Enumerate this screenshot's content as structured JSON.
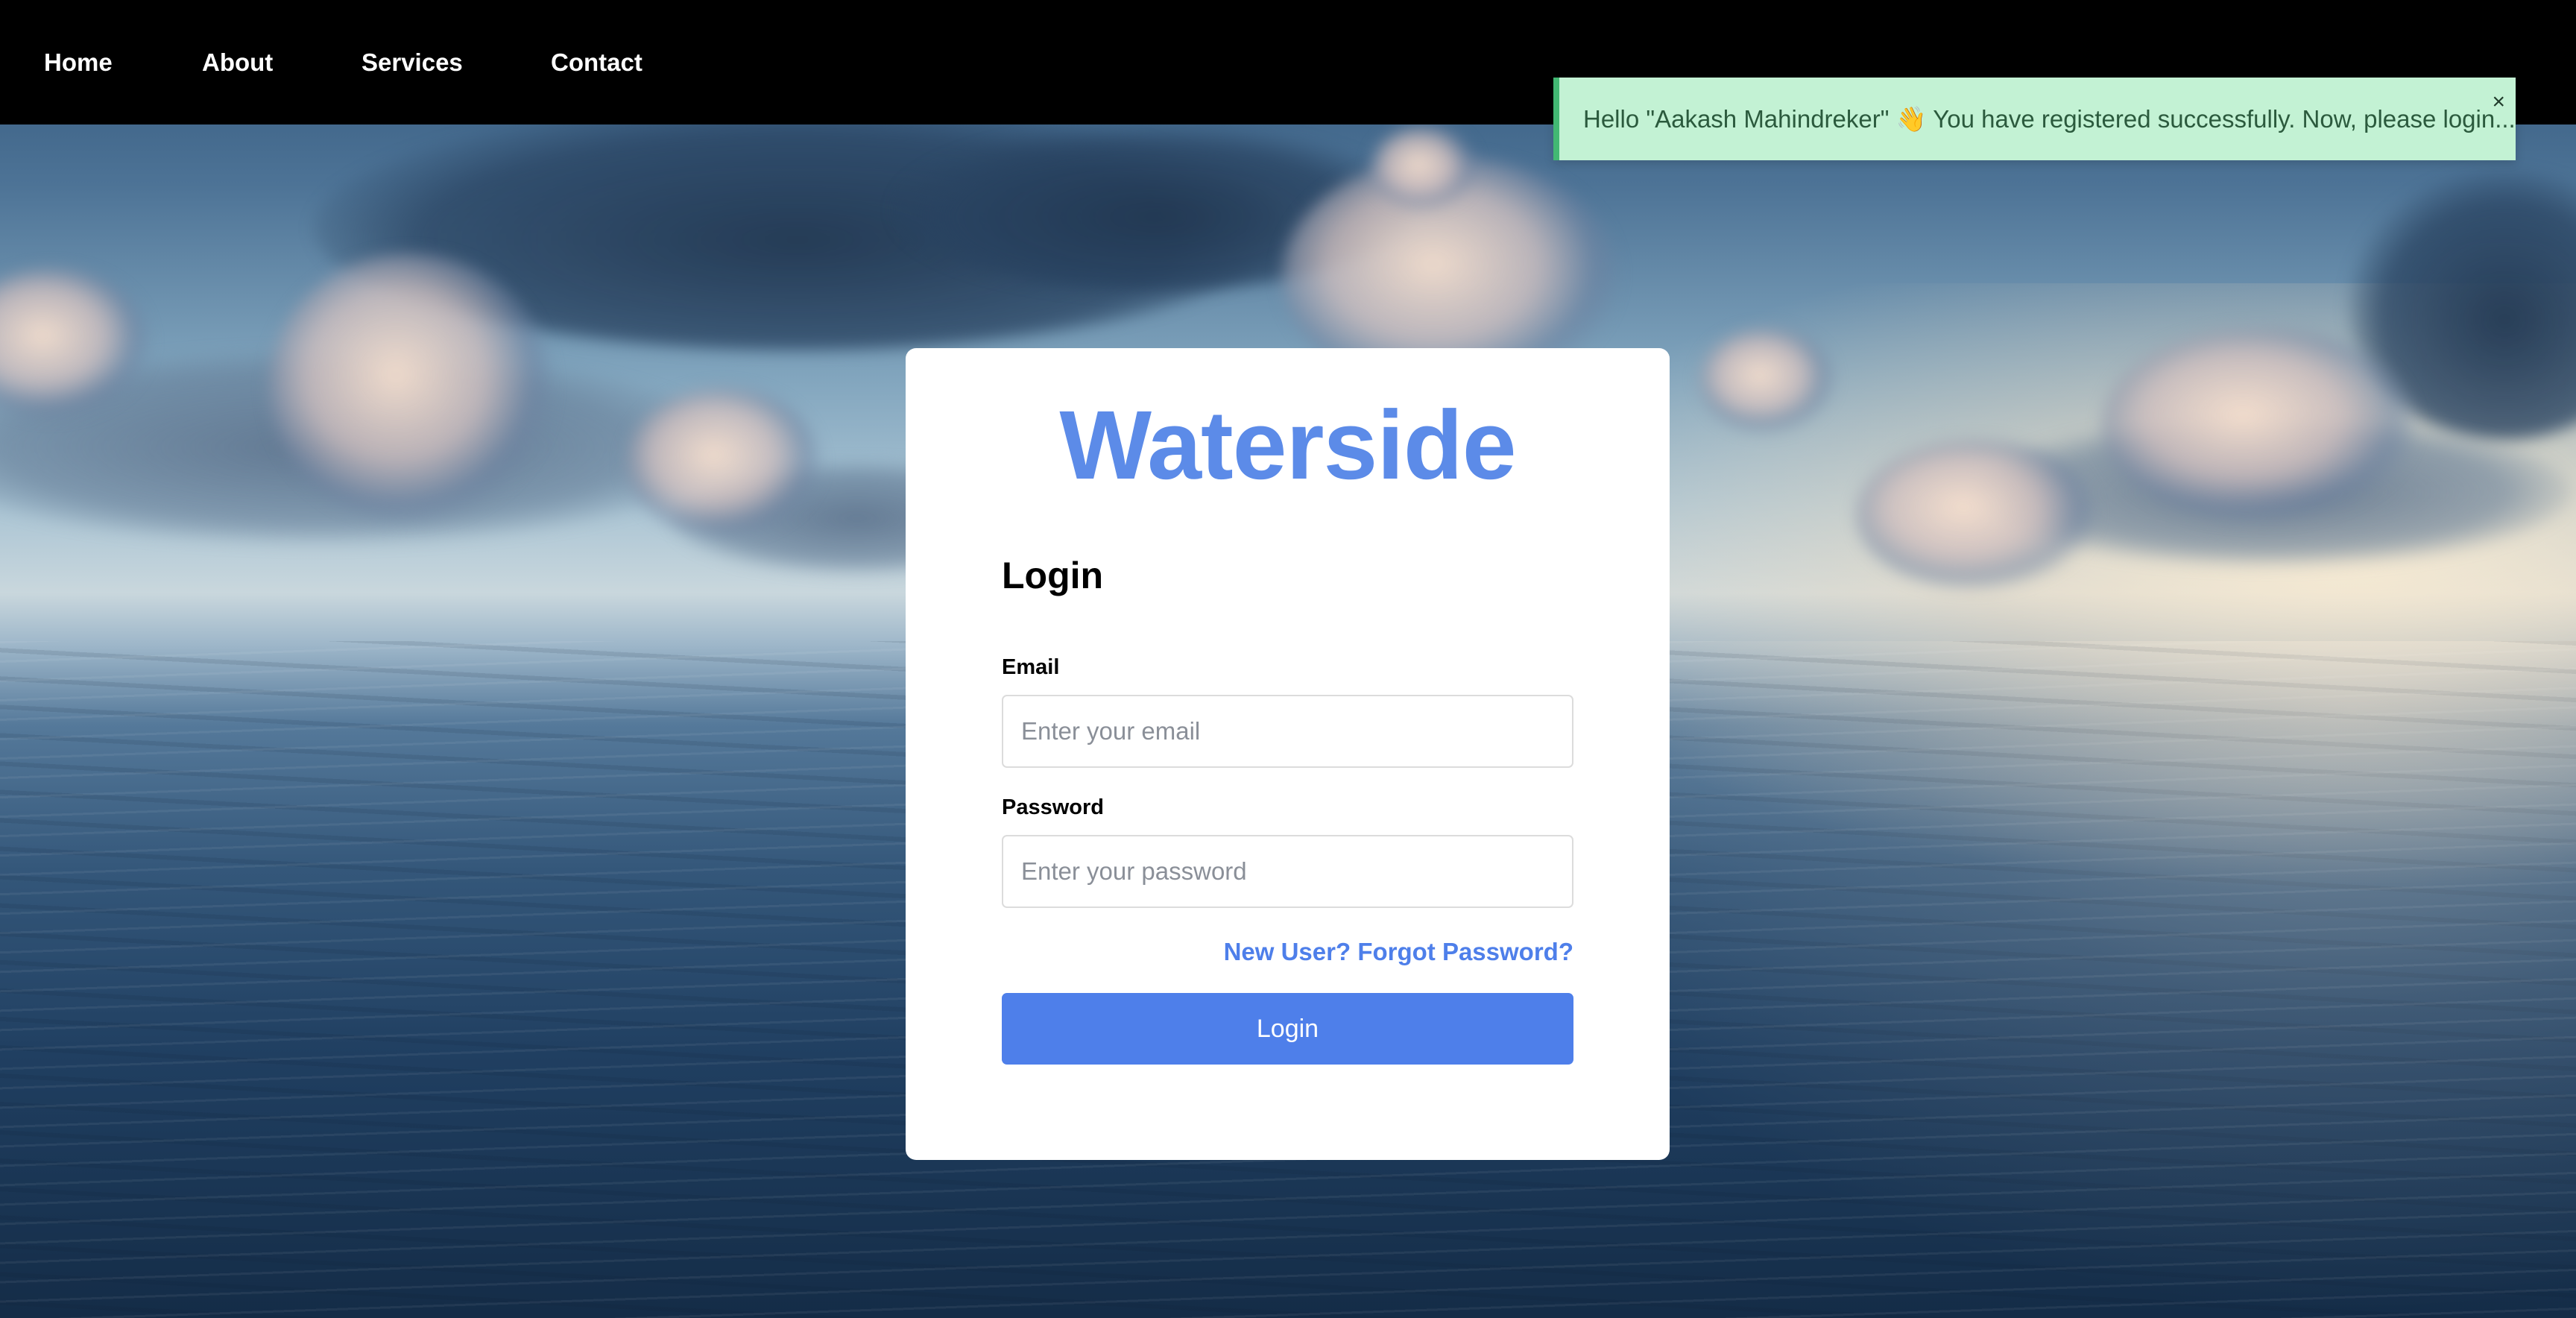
{
  "nav": {
    "items": [
      {
        "label": "Home"
      },
      {
        "label": "About"
      },
      {
        "label": "Services"
      },
      {
        "label": "Contact"
      }
    ]
  },
  "toast": {
    "message": "Hello \"Aakash Mahindreker\" 👋 You have registered successfully. Now, please login...",
    "close_glyph": "×",
    "accent_color": "#42b873",
    "background_color": "#c3f2d4"
  },
  "login_card": {
    "brand": "Waterside",
    "brand_color": "#5c8be8",
    "title": "Login",
    "email": {
      "label": "Email",
      "placeholder": "Enter your email",
      "value": ""
    },
    "password": {
      "label": "Password",
      "placeholder": "Enter your password",
      "value": ""
    },
    "new_user_link": "New User?",
    "forgot_password_link": "Forgot Password?",
    "submit_label": "Login",
    "accent_color": "#4e7fea"
  },
  "background": {
    "description_icon": "ocean-sky-background"
  }
}
